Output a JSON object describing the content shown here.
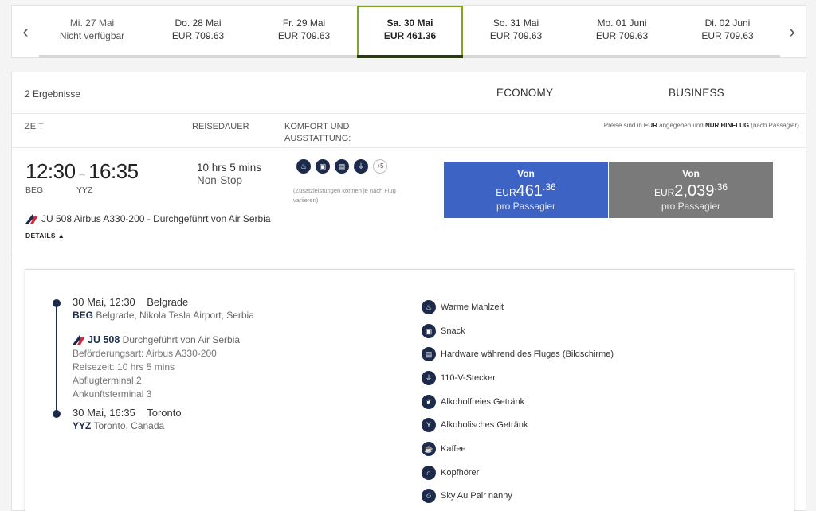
{
  "date_strip": {
    "prev_icon": "chevron-left-icon",
    "next_icon": "chevron-right-icon",
    "prev_glyph": "‹",
    "next_glyph": "›",
    "dates": [
      {
        "date": "Mi. 27 Mai",
        "price": "Nicht verfügbar"
      },
      {
        "date": "Do. 28 Mai",
        "price": "EUR 709.63"
      },
      {
        "date": "Fr. 29 Mai",
        "price": "EUR 709.63"
      },
      {
        "date": "Sa. 30 Mai",
        "price": "EUR 461.36"
      },
      {
        "date": "So. 31 Mai",
        "price": "EUR 709.63"
      },
      {
        "date": "Mo. 01 Juni",
        "price": "EUR 709.63"
      },
      {
        "date": "Di. 02 Juni",
        "price": "EUR 709.63"
      }
    ],
    "selected_index": 3,
    "selected_color": "#7fa52b"
  },
  "results": {
    "count": "2 Ergebnisse",
    "economy": "ECONOMY",
    "business": "BUSINESS",
    "col_time": "ZEIT",
    "col_duration": "REISEDAUER",
    "col_comfort_1": "KOMFORT UND",
    "col_comfort_2": "AUSSTATTUNG:",
    "price_note_1": "Preise sind in ",
    "price_note_currency": "EUR",
    "price_note_2": " angegeben und ",
    "price_note_oneway": "NUR HINFLUG",
    "price_note_3": " (nach Passagier)."
  },
  "flight": {
    "dep_time": "12:30",
    "arrow": "→",
    "arr_time": "16:35",
    "dep_code": "BEG",
    "arr_code": "YYZ",
    "duration": "10 hrs 5 mins",
    "stops": "Non-Stop",
    "amenity_more": "+5",
    "amenity_note": "(Zusatzleistungen können je nach Flug variieren)",
    "info": "JU 508 Airbus A330-200 - Durchgeführt von Air Serbia",
    "details_label": "DETAILS ▲"
  },
  "fares": {
    "economy": {
      "from": "Von",
      "currency": "EUR",
      "amount": "461",
      "cents": ".36",
      "per": "pro Passagier",
      "color": "#3d63c4"
    },
    "business": {
      "from": "Von",
      "currency": "EUR",
      "amount": "2,039",
      "cents": ".36",
      "per": "pro Passagier",
      "color": "#7a7a7a"
    }
  },
  "details": {
    "departure": {
      "when": "30 Mai, 12:30",
      "city": "Belgrade",
      "code": "BEG",
      "airport": " Belgrade, Nikola Tesla Airport, Serbia"
    },
    "flight_no": "JU 508",
    "operated": " Durchgeführt von Air Serbia",
    "aircraft": "Beförderungsart: Airbus A330-200",
    "travel_time": "Reisezeit: 10 hrs 5 mins",
    "dep_terminal": "Abflugterminal 2",
    "arr_terminal": "Ankunftsterminal 3",
    "arrival": {
      "when": "30 Mai, 16:35",
      "city": "Toronto",
      "code": "YYZ",
      "airport": " Toronto, Canada"
    },
    "amenities": [
      {
        "label": "Warme Mahlzeit",
        "icon": "hot-meal-icon",
        "glyph": "♨"
      },
      {
        "label": "Snack",
        "icon": "snack-icon",
        "glyph": "▣"
      },
      {
        "label": "Hardware während des Fluges (Bildschirme)",
        "icon": "screen-icon",
        "glyph": "▤"
      },
      {
        "label": "110-V-Stecker",
        "icon": "power-plug-icon",
        "glyph": "⏚"
      },
      {
        "label": "Alkoholfreies Getränk",
        "icon": "soft-drink-icon",
        "glyph": "❦"
      },
      {
        "label": "Alkoholisches Getränk",
        "icon": "cocktail-icon",
        "glyph": "Y"
      },
      {
        "label": "Kaffee",
        "icon": "coffee-icon",
        "glyph": "☕"
      },
      {
        "label": "Kopfhörer",
        "icon": "headphones-icon",
        "glyph": "∩"
      },
      {
        "label": "Sky Au Pair nanny",
        "icon": "nanny-icon",
        "glyph": "☺"
      }
    ]
  }
}
